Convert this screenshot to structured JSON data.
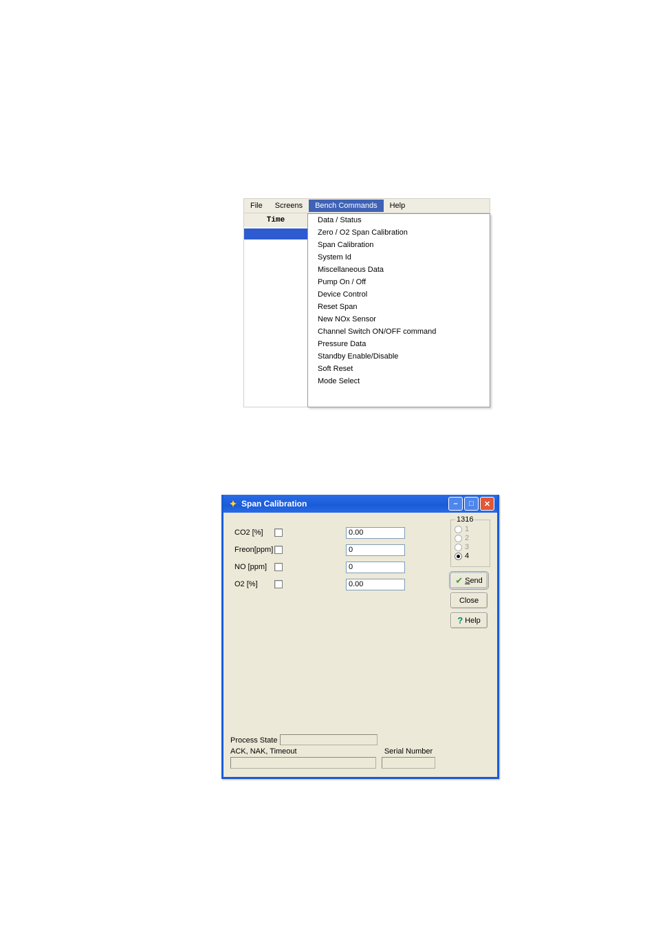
{
  "menubar": {
    "items": [
      {
        "label": "File"
      },
      {
        "label": "Screens"
      },
      {
        "label": "Bench Commands",
        "selected": true
      },
      {
        "label": "Help"
      }
    ],
    "time_header": "Time",
    "dropdown": [
      "Data / Status",
      "Zero / O2 Span Calibration",
      "Span Calibration",
      "System Id",
      "Miscellaneous Data",
      "Pump On / Off",
      "Device Control",
      "Reset Span",
      "New NOx Sensor",
      "Channel Switch ON/OFF command",
      "Pressure Data",
      "Standby Enable/Disable",
      "Soft Reset",
      "Mode Select"
    ]
  },
  "dialog": {
    "title": "Span Calibration",
    "fields": [
      {
        "label": "CO2 [%]",
        "checked": false,
        "value": "0.00"
      },
      {
        "label": "Freon[ppm]",
        "checked": false,
        "value": "0"
      },
      {
        "label": "NO [ppm]",
        "checked": false,
        "value": "0"
      },
      {
        "label": "O2 [%]",
        "checked": false,
        "value": "0.00"
      }
    ],
    "group": {
      "legend": "1316",
      "options": [
        {
          "label": "1",
          "disabled": true,
          "selected": false
        },
        {
          "label": "2",
          "disabled": true,
          "selected": false
        },
        {
          "label": "3",
          "disabled": true,
          "selected": false
        },
        {
          "label": "4",
          "disabled": false,
          "selected": true
        }
      ]
    },
    "buttons": {
      "send": "Send",
      "close": "Close",
      "help": "Help"
    },
    "bottom": {
      "process_state_label": "Process State",
      "ack_label": "ACK, NAK, Timeout",
      "serial_label": "Serial Number"
    }
  }
}
